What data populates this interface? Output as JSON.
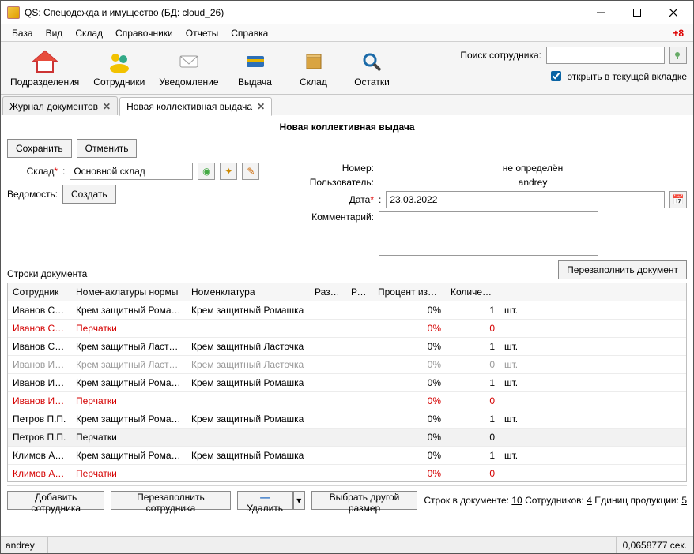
{
  "window": {
    "title": "QS: Спецодежда и имущество (БД: cloud_26)"
  },
  "menu": {
    "items": [
      "База",
      "Вид",
      "Склад",
      "Справочники",
      "Отчеты",
      "Справка"
    ],
    "update_badge": "+8"
  },
  "toolbar": {
    "buttons": [
      {
        "id": "departments",
        "label": "Подразделения"
      },
      {
        "id": "employees",
        "label": "Сотрудники"
      },
      {
        "id": "notify",
        "label": "Уведомление"
      },
      {
        "id": "issue",
        "label": "Выдача"
      },
      {
        "id": "warehouse",
        "label": "Склад"
      },
      {
        "id": "stock",
        "label": "Остатки"
      }
    ],
    "search_label": "Поиск сотрудника:",
    "search_value": "",
    "open_in_tab_label": "открыть в текущей вкладке",
    "open_in_tab_checked": true
  },
  "tabs": {
    "items": [
      {
        "label": "Журнал документов",
        "active": false
      },
      {
        "label": "Новая коллективная выдача",
        "active": true
      }
    ]
  },
  "doc": {
    "heading": "Новая коллективная выдача",
    "save_label": "Сохранить",
    "cancel_label": "Отменить",
    "warehouse_label": "Склад",
    "warehouse_value": "Основной склад",
    "vedomost_label": "Ведомость:",
    "create_label": "Создать",
    "number_label": "Номер:",
    "number_value": "не определён",
    "user_label": "Пользователь:",
    "user_value": "andrey",
    "date_label": "Дата",
    "date_value": "23.03.2022",
    "comment_label": "Комментарий:",
    "comment_value": "",
    "lines_label": "Строки документа",
    "refill_doc_label": "Перезаполнить документ"
  },
  "grid": {
    "columns": {
      "employee": "Сотрудник",
      "norm": "Номенаклатуры нормы",
      "nomenclature": "Номенклатура",
      "size": "Размер",
      "height": "Рост",
      "wear_pct": "Процент износа",
      "qty": "Количество",
      "unit": ""
    },
    "rows": [
      {
        "emp": "Иванов С.П.",
        "norm": "Крем защитный Ромашка",
        "nom": "Крем защитный Ромашка",
        "pct": "0%",
        "qty": "1",
        "unit": "шт.",
        "style": ""
      },
      {
        "emp": "Иванов С.П.",
        "norm": "Перчатки",
        "nom": "",
        "pct": "0%",
        "qty": "0",
        "unit": "",
        "style": "mis"
      },
      {
        "emp": "Иванов С.П.",
        "norm": "Крем защитный Ласточка",
        "nom": "Крем защитный Ласточка",
        "pct": "0%",
        "qty": "1",
        "unit": "шт.",
        "style": ""
      },
      {
        "emp": "Иванов И.И.",
        "norm": "Крем защитный Ласточка",
        "nom": "Крем защитный Ласточка",
        "pct": "0%",
        "qty": "0",
        "unit": "шт.",
        "style": "dim"
      },
      {
        "emp": "Иванов И.И.",
        "norm": "Крем защитный Ромашка",
        "nom": "Крем защитный Ромашка",
        "pct": "0%",
        "qty": "1",
        "unit": "шт.",
        "style": ""
      },
      {
        "emp": "Иванов И.И.",
        "norm": "Перчатки",
        "nom": "",
        "pct": "0%",
        "qty": "0",
        "unit": "",
        "style": "mis"
      },
      {
        "emp": "Петров П.П.",
        "norm": "Крем защитный Ромашка",
        "nom": "Крем защитный Ромашка",
        "pct": "0%",
        "qty": "1",
        "unit": "шт.",
        "style": ""
      },
      {
        "emp": "Петров П.П.",
        "norm": "Перчатки",
        "nom": "",
        "pct": "0%",
        "qty": "0",
        "unit": "",
        "style": "sel"
      },
      {
        "emp": "Климов А.М.",
        "norm": "Крем защитный Ромашка",
        "nom": "Крем защитный Ромашка",
        "pct": "0%",
        "qty": "1",
        "unit": "шт.",
        "style": ""
      },
      {
        "emp": "Климов А.М.",
        "norm": "Перчатки",
        "nom": "",
        "pct": "0%",
        "qty": "0",
        "unit": "",
        "style": "mis"
      }
    ]
  },
  "bottom": {
    "add_employee": "Добавить сотрудника",
    "refill_employee": "Перезаполнить сотрудника",
    "delete_label": "Удалить",
    "choose_size": "Выбрать другой размер",
    "stats_rows_label": "Строк в документе:",
    "stats_rows_value": "10",
    "stats_emps_label": "Сотрудников:",
    "stats_emps_value": "4",
    "stats_units_label": "Единиц продукции:",
    "stats_units_value": "5"
  },
  "status": {
    "user": "andrey",
    "timing": "0,0658777 сек."
  }
}
